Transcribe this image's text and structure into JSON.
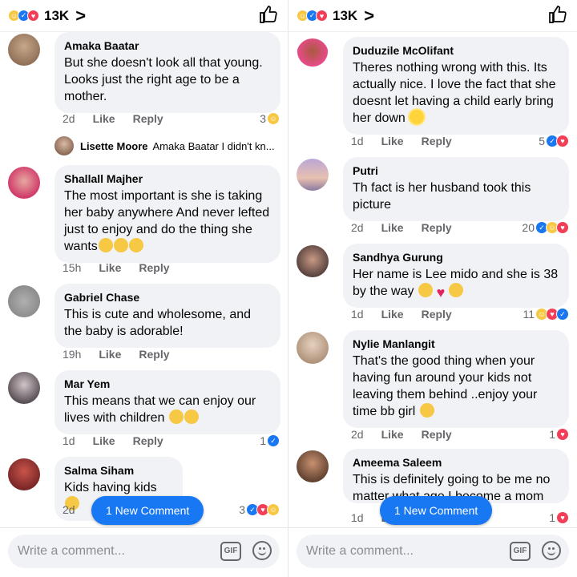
{
  "header": {
    "count": "13K",
    "chevron": ">",
    "reactions": [
      "haha-icon",
      "like-icon",
      "love-icon"
    ]
  },
  "new_comment_label": "1 New Comment",
  "composer": {
    "placeholder": "Write a comment...",
    "gif": "GIF"
  },
  "left": {
    "comments": [
      {
        "name": "Amaka Baatar",
        "text": "But she doesn't look all that young. Looks just the right age to be a mother.",
        "time": "2d",
        "like": "Like",
        "reply": "Reply",
        "count": "3",
        "reactions": [
          "haha"
        ]
      },
      {
        "reply_preview": {
          "name": "Lisette Moore",
          "text": "Amaka Baatar I didn't kn..."
        }
      },
      {
        "name": "Shallall Majher",
        "text": "The most important is she is taking her baby anywhere And never lefted just to enjoy and do the thing she wants",
        "time": "15h",
        "like": "Like",
        "reply": "Reply"
      },
      {
        "name": "Gabriel Chase",
        "text": "This is cute and wholesome, and the baby is adorable!",
        "time": "19h",
        "like": "Like",
        "reply": "Reply"
      },
      {
        "name": "Mar Yem",
        "text": "This means that we can enjoy our lives with children",
        "time": "1d",
        "like": "Like",
        "reply": "Reply",
        "count": "1",
        "reactions": [
          "like"
        ]
      },
      {
        "name": "Salma Siham",
        "text": "Kids having kids",
        "time": "2d",
        "like": "L",
        "count": "3",
        "reactions": [
          "like",
          "love",
          "haha"
        ]
      }
    ]
  },
  "right": {
    "comments": [
      {
        "name": "Duduzile McOlifant",
        "text": "Theres nothing wrong with this. Its actually nice. I love the fact that she doesnt let having a child early bring her down",
        "time": "1d",
        "like": "Like",
        "reply": "Reply",
        "count": "5",
        "reactions": [
          "like",
          "love"
        ]
      },
      {
        "name": "Putri",
        "text": "Th fact is her husband took this picture",
        "time": "2d",
        "like": "Like",
        "reply": "Reply",
        "count": "20",
        "reactions": [
          "like",
          "haha",
          "love"
        ]
      },
      {
        "name": "Sandhya Gurung",
        "text": "Her name is Lee mido and she is 38 by the way",
        "time": "1d",
        "like": "Like",
        "reply": "Reply",
        "count": "11",
        "reactions": [
          "haha",
          "love",
          "like"
        ]
      },
      {
        "name": "Nylie Manlangit",
        "text": "That's the good thing when your having fun around your kids not leaving them behind ..enjoy your time bb girl",
        "time": "2d",
        "like": "Like",
        "reply": "Reply",
        "count": "1",
        "reactions": [
          "love"
        ]
      },
      {
        "name": "Ameema Saleem",
        "text": "This is definitely going to be me no matter what age I become a mom",
        "time": "1d",
        "like": "Li",
        "count": "1",
        "reactions": [
          "love"
        ]
      }
    ]
  },
  "colors": {
    "accent": "#1877f2",
    "bubble": "#f0f2f5",
    "meta": "#65676b"
  }
}
